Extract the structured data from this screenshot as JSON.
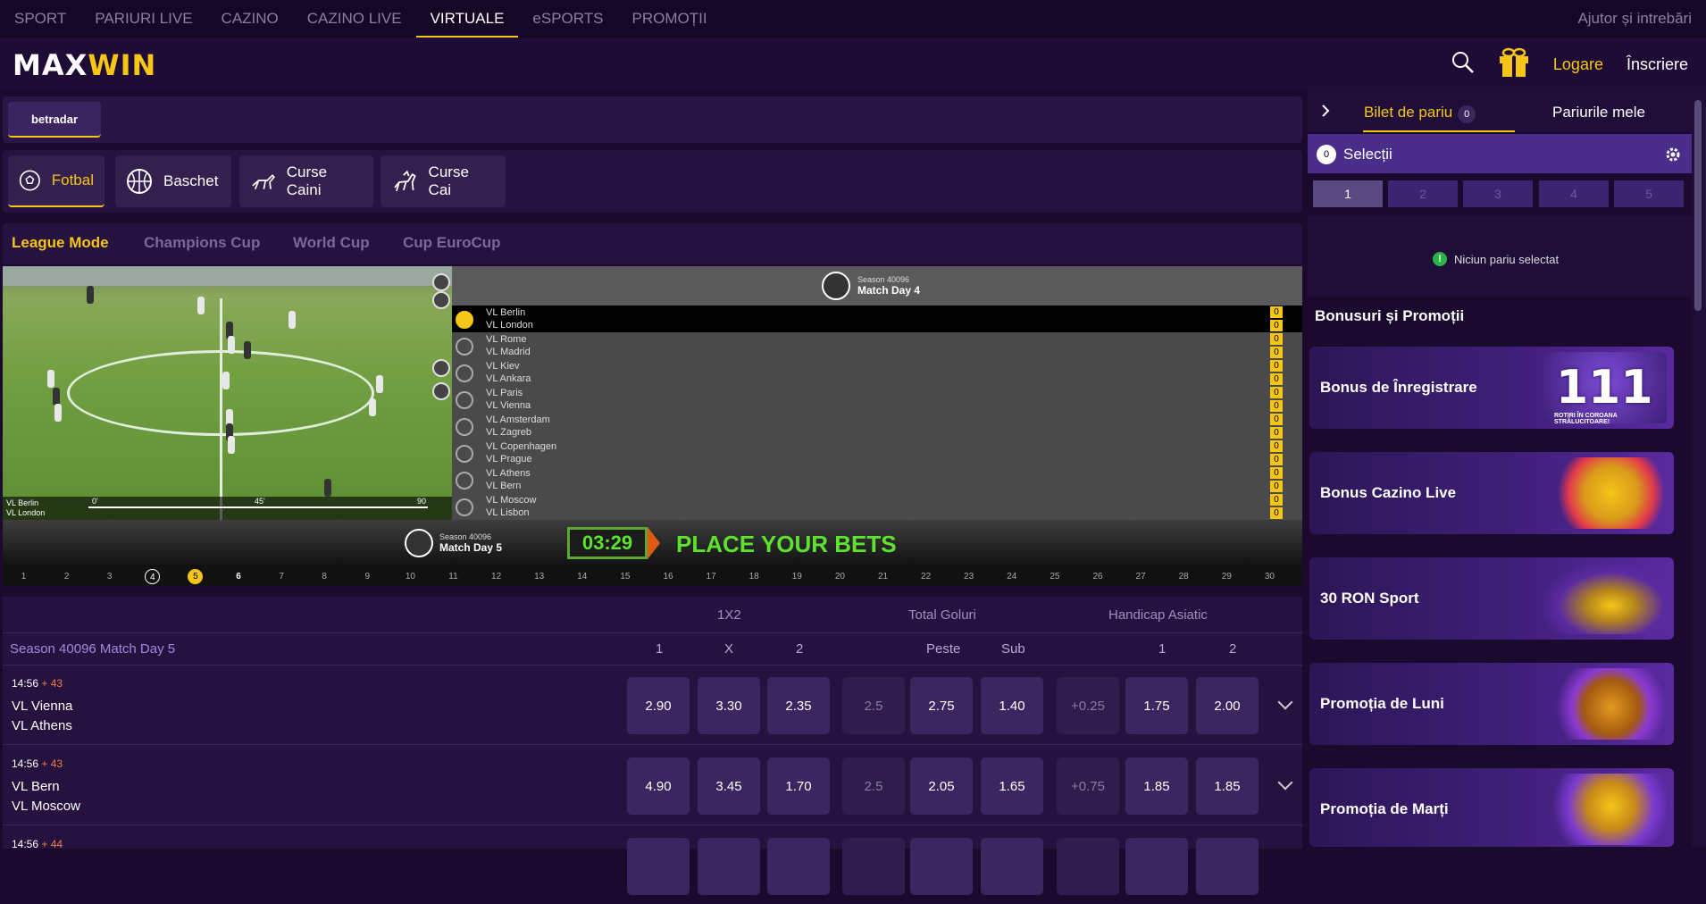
{
  "topnav": {
    "items": [
      "SPORT",
      "PARIURI LIVE",
      "CAZINO",
      "CAZINO LIVE",
      "VIRTUALE",
      "eSPORTS",
      "PROMOȚII"
    ],
    "active": "VIRTUALE",
    "help": "Ajutor și intrebări"
  },
  "header": {
    "logo_a": "MAX",
    "logo_b": "WIN",
    "login": "Logare",
    "register": "Înscriere"
  },
  "provider": "betradar",
  "sports": [
    "Fotbal",
    "Baschet",
    "Curse Caini",
    "Curse Cai"
  ],
  "modes": [
    "League Mode",
    "Champions Cup",
    "World Cup",
    "Cup EuroCup"
  ],
  "video": {
    "team_a": "VL Berlin",
    "team_b": "VL London",
    "t0": "0'",
    "t45": "45'",
    "t90": "90"
  },
  "matchlist": {
    "season": "Season 40096",
    "matchday": "Match Day 4",
    "matches": [
      {
        "a": "VL Berlin",
        "b": "VL London",
        "sa": "0",
        "sb": "0"
      },
      {
        "a": "VL Rome",
        "b": "VL Madrid",
        "sa": "0",
        "sb": "0"
      },
      {
        "a": "VL Kiev",
        "b": "VL Ankara",
        "sa": "0",
        "sb": "0"
      },
      {
        "a": "VL Paris",
        "b": "VL Vienna",
        "sa": "0",
        "sb": "0"
      },
      {
        "a": "VL Amsterdam",
        "b": "VL Zagreb",
        "sa": "0",
        "sb": "0"
      },
      {
        "a": "VL Copenhagen",
        "b": "VL Prague",
        "sa": "0",
        "sb": "0"
      },
      {
        "a": "VL Athens",
        "b": "VL Bern",
        "sa": "0",
        "sb": "0"
      },
      {
        "a": "VL Moscow",
        "b": "VL Lisbon",
        "sa": "0",
        "sb": "0"
      }
    ]
  },
  "countdown": {
    "season": "Season 40096",
    "matchday": "Match Day 5",
    "timer": "03:29",
    "message": "PLACE YOUR BETS"
  },
  "days": [
    "1",
    "2",
    "3",
    "4",
    "5",
    "6",
    "7",
    "8",
    "9",
    "10",
    "11",
    "12",
    "13",
    "14",
    "15",
    "16",
    "17",
    "18",
    "19",
    "20",
    "21",
    "22",
    "23",
    "24",
    "25",
    "26",
    "27",
    "28",
    "29",
    "30"
  ],
  "odds": {
    "groups": [
      "1X2",
      "Total Goluri",
      "Handicap Asiatic"
    ],
    "season_title": "Season 40096 Match Day 5",
    "subs": {
      "one": "1",
      "x": "X",
      "two": "2",
      "over": "Peste",
      "under": "Sub",
      "h1": "1",
      "h2": "2"
    },
    "rows": [
      {
        "time": "14:56",
        "plus": "+ 43",
        "a": "VL Vienna",
        "b": "VL Athens",
        "o": [
          "2.90",
          "3.30",
          "2.35",
          "2.5",
          "2.75",
          "1.40",
          "+0.25",
          "1.75",
          "2.00"
        ]
      },
      {
        "time": "14:56",
        "plus": "+ 43",
        "a": "VL Bern",
        "b": "VL Moscow",
        "o": [
          "4.90",
          "3.45",
          "1.70",
          "2.5",
          "2.05",
          "1.65",
          "+0.75",
          "1.85",
          "1.85"
        ]
      },
      {
        "time": "14:56",
        "plus": "+ 44",
        "a": "",
        "b": "",
        "o": [
          "",
          "",
          "",
          "",
          "",
          "",
          "",
          "",
          ""
        ]
      }
    ]
  },
  "betslip": {
    "tab1": "Bilet de pariu",
    "tab1_count": "0",
    "tab2": "Pariurile mele",
    "sel_count": "0",
    "sel_label": "Selecții",
    "numbers": [
      "1",
      "2",
      "3",
      "4",
      "5"
    ],
    "nobet": "Niciun pariu selectat"
  },
  "bonus": {
    "title": "Bonusuri și Promoții",
    "items": [
      {
        "label": "Bonus de Înregistrare",
        "art": "111",
        "sub": "ROTIRI ÎN COROANA STRĂLUCITOARE!"
      },
      {
        "label": "Bonus Cazino Live"
      },
      {
        "label": "30 RON Sport"
      },
      {
        "label": "Promoția de Luni"
      },
      {
        "label": "Promoția de Marți"
      }
    ]
  },
  "colors": {
    "accent": "#f5c518",
    "bg": "#1a0b2e",
    "timer_green": "#5de22f"
  }
}
